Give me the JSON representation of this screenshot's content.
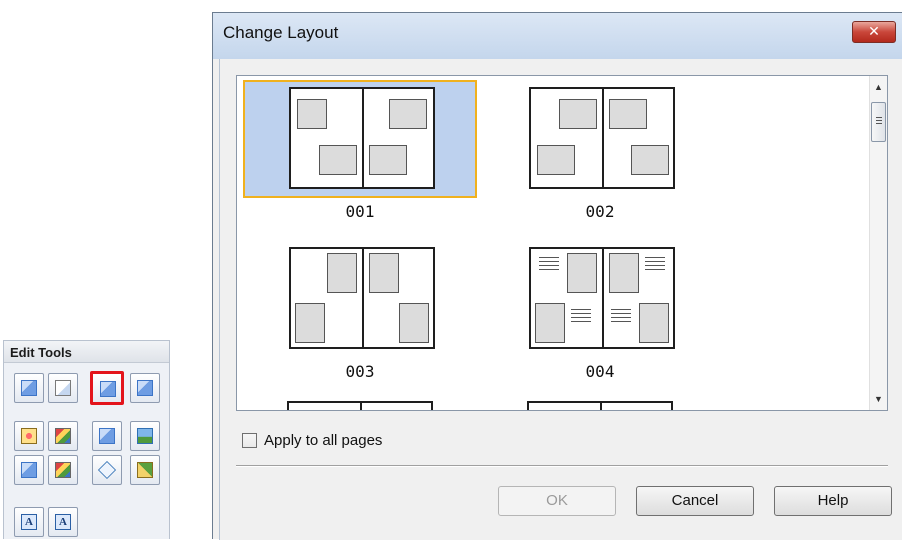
{
  "edit_tools": {
    "title": "Edit Tools",
    "rows": [
      [
        "rotate-page-icon",
        "page-settings-icon",
        "change-layout-icon",
        "change-background-icon"
      ],
      [
        "add-image-icon",
        "arrange-images-icon",
        "swap-images-icon",
        "insert-photo-icon"
      ],
      [
        "add-page-icon",
        "duplicate-page-icon",
        "frame-icon",
        "date-stamp-icon"
      ],
      [
        "add-text-icon",
        "vertical-text-icon"
      ]
    ],
    "highlighted_tool": "change-layout-icon"
  },
  "dialog": {
    "title": "Change Layout",
    "close_label": "✕",
    "layouts": [
      {
        "id": "001",
        "label": "001",
        "selected": true
      },
      {
        "id": "002",
        "label": "002",
        "selected": false
      },
      {
        "id": "003",
        "label": "003",
        "selected": false
      },
      {
        "id": "004",
        "label": "004",
        "selected": false
      }
    ],
    "scrollbar": {
      "up_icon": "▲",
      "down_icon": "▼"
    },
    "apply_all": {
      "label": "Apply to all pages",
      "checked": false
    },
    "buttons": {
      "ok": "OK",
      "ok_enabled": false,
      "cancel": "Cancel",
      "help": "Help"
    }
  },
  "colors": {
    "selection_fill": "#bdd1ee",
    "selection_border": "#f0b11e",
    "highlight_red": "#e3141b"
  }
}
